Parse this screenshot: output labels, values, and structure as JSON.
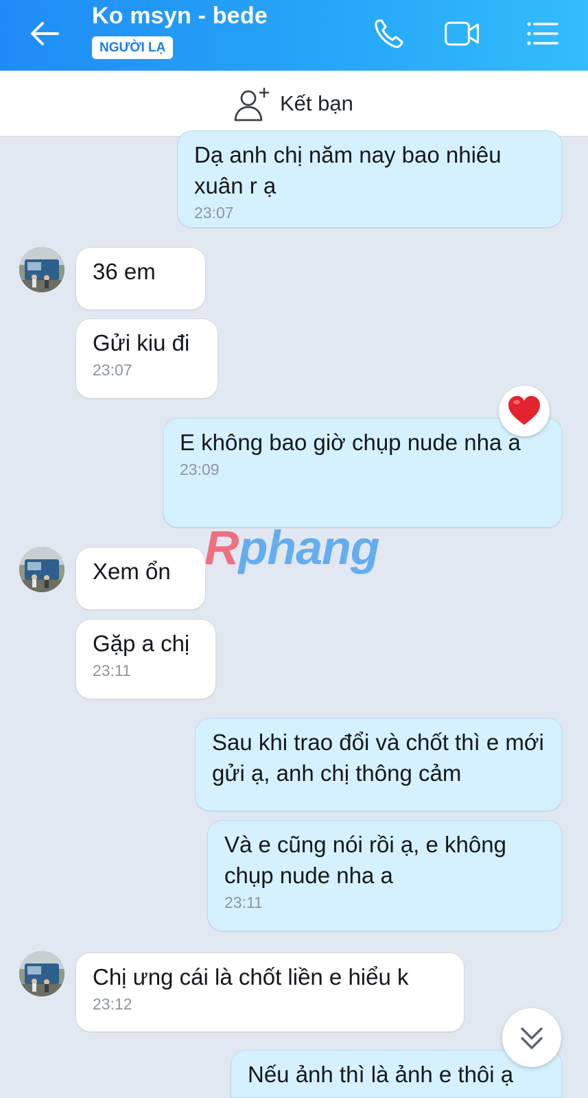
{
  "header": {
    "title": "Ko msyn - bede",
    "badge": "NGƯỜI LẠ",
    "back_icon": "arrow-left-icon",
    "call_icon": "phone-icon",
    "video_icon": "video-camera-icon",
    "menu_icon": "list-menu-icon",
    "accent_color": "#1f8cf5"
  },
  "friend_bar": {
    "label": "Kết bạn",
    "icon": "add-friend-icon"
  },
  "messages": [
    {
      "side": "out",
      "text": "Dạ anh chị năm nay bao nhiêu xuân r ạ",
      "time": "23:07"
    },
    {
      "side": "in",
      "text": "36 em",
      "time": ""
    },
    {
      "side": "in",
      "text": "Gửi kiu đi",
      "time": "23:07"
    },
    {
      "side": "out",
      "text": "E không bao giờ chụp nude nha a",
      "time": "23:09",
      "reaction": "heart-icon"
    },
    {
      "side": "in",
      "text": "Xem ổn",
      "time": ""
    },
    {
      "side": "in",
      "text": "Gặp a chị",
      "time": "23:11"
    },
    {
      "side": "out",
      "text": "Sau khi trao đổi và chốt thì e mới gửi ạ, anh chị thông cảm",
      "time": ""
    },
    {
      "side": "out",
      "text": "Và e cũng nói rồi ạ, e không chụp nude nha a",
      "time": "23:11"
    },
    {
      "side": "in",
      "text": "Chị ưng cái là chốt liền e hiểu k",
      "time": "23:12"
    },
    {
      "side": "out",
      "text": "Nếu ảnh thì là ảnh e thôi ạ",
      "time": ""
    }
  ],
  "watermark": {
    "first": "R",
    "rest": "phang"
  },
  "scroll_down_icon": "double-chevron-down-icon",
  "colors": {
    "incoming": "#ffffff",
    "outgoing": "#d5f1ff",
    "background": "#e2e8f1"
  }
}
